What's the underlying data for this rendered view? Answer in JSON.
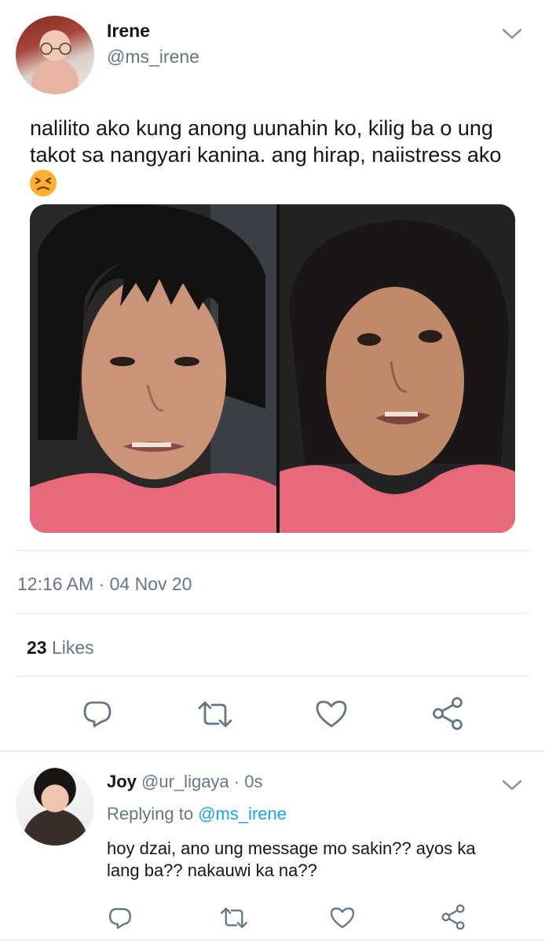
{
  "tweet": {
    "author_name": "Irene",
    "author_handle": "@ms_irene",
    "text_line1": "nalilito ako kung anong uunahin ko, kilig ba o ung",
    "text_line2": "takot sa nangyari kanina. ang hirap, naiistress ako",
    "emoji": "persevering-face-emoji",
    "timestamp": "12:16 AM · 04 Nov 20",
    "likes_count": "23",
    "likes_label": "Likes"
  },
  "reply": {
    "author_name": "Joy",
    "author_handle": "@ur_ligaya",
    "time": "· 0s",
    "replying_prefix": "Replying to",
    "replying_to": "@ms_irene",
    "text_line1": "hoy dzai, ano ung message mo sakin?? ayos ka",
    "text_line2": "lang ba?? nakauwi ka na??"
  },
  "icons": {
    "reply": "reply-icon",
    "retweet": "retweet-icon",
    "like": "heart-icon",
    "share": "share-icon",
    "more": "chevron-down-icon"
  },
  "colors": {
    "accent": "#1da1f2",
    "muted": "#657786",
    "icon": "#657786"
  }
}
